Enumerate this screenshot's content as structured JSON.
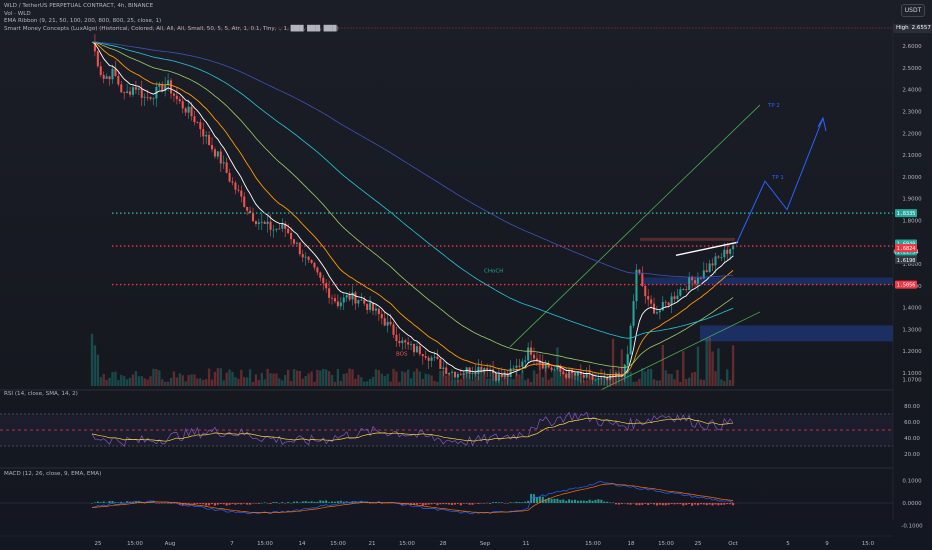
{
  "header": {
    "symbol_line": "WLD / TetherUS PERPETUAL CONTRACT, 4h, BINANCE",
    "indicators": [
      "Vol · WLD",
      "EMA Ribbon (9, 21, 50, 100, 200, 800, 800, 25, close, 1)",
      "Smart Money Concepts (LuxAlgo) (Historical, Colored, All, All, All, Small, 50, 5, 5, Atr, 1, 0.1, Tiny, ., 1, ███, ███, ███)"
    ],
    "currency_button": "USDT"
  },
  "price_axis": {
    "high_label": "High",
    "high_value": "2.6557",
    "ticks": [
      "2.6000",
      "2.5000",
      "2.4000",
      "2.3000",
      "2.2000",
      "2.1000",
      "2.0000",
      "1.9000",
      "1.8000",
      "1.6000",
      "1.5000",
      "1.4000",
      "1.3000",
      "1.2000",
      "1.1000",
      "1.0700"
    ],
    "badges": [
      {
        "text": "1.8335",
        "color": "#26a69a"
      },
      {
        "text": "1.6940",
        "color": "#26a69a"
      },
      {
        "text": "01:21:54",
        "color": "#26a69a"
      },
      {
        "text": "1.6824",
        "color": "#f23645"
      },
      {
        "text": "1.6190",
        "color": "#363a45"
      },
      {
        "text": "1.5056",
        "color": "#f23645"
      }
    ]
  },
  "rsi_panel": {
    "title": "RSI (14, close, SMA, 14, 2)",
    "ticks": [
      "80.00",
      "60.00",
      "40.00",
      "20.00"
    ]
  },
  "macd_panel": {
    "title": "MACD (12, 26, close, 9, EMA, EMA)",
    "ticks": [
      "0.1000",
      "0.0000",
      "-0.1000"
    ]
  },
  "time_axis": [
    "25",
    "15:00",
    "Aug",
    "7",
    "15:00",
    "14",
    "15:00",
    "21",
    "15:00",
    "28",
    "Sep",
    "11",
    "15:00",
    "18",
    "15:00",
    "25",
    "Oct",
    "5",
    "9",
    "15:0"
  ],
  "annotations": {
    "tp1": "TP 1",
    "tp2": "TP 2",
    "bos": "BOS",
    "choch": "CHoCH",
    "choch2": "CHoCH"
  },
  "colors": {
    "background": "#131722",
    "up": "#26a69a",
    "down": "#ef5350",
    "ema_fast": "#ffffff",
    "ema_mid": "#ff9800",
    "ema_slow1": "#9ccc65",
    "ema_slow2": "#26c6da",
    "ema_slow3": "#3f51b5",
    "channel": "#4caf50",
    "projection": "#2962ff"
  },
  "chart_data": [
    {
      "type": "candlestick",
      "title": "WLD / TetherUS PERPETUAL CONTRACT, 4h, BINANCE",
      "ylim": [
        1.04,
        2.72
      ],
      "log_scale": false,
      "grid": false,
      "path_prices": [
        2.62,
        2.45,
        2.48,
        2.37,
        2.42,
        2.36,
        2.39,
        2.43,
        2.35,
        2.3,
        2.24,
        2.15,
        2.08,
        1.98,
        1.9,
        1.82,
        1.78,
        1.76,
        1.77,
        1.7,
        1.62,
        1.55,
        1.48,
        1.42,
        1.45,
        1.44,
        1.4,
        1.36,
        1.3,
        1.24,
        1.21,
        1.2,
        1.16,
        1.12,
        1.1,
        1.11,
        1.12,
        1.13,
        1.08,
        1.09,
        1.14,
        1.21,
        1.15,
        1.12,
        1.1,
        1.09,
        1.08,
        1.07,
        1.06,
        1.08,
        1.12,
        1.58,
        1.42,
        1.38,
        1.43,
        1.48,
        1.52,
        1.55,
        1.6,
        1.64,
        1.69
      ],
      "key_levels": [
        {
          "price": 1.8335,
          "style": "dotted",
          "color": "#26a69a"
        },
        {
          "price": 1.6824,
          "style": "dotted",
          "color": "#f23645"
        },
        {
          "price": 1.5056,
          "style": "dotted",
          "color": "#f23645"
        }
      ],
      "projection_path": [
        1.69,
        1.98,
        1.85,
        2.27
      ],
      "targets": [
        {
          "label": "TP 1",
          "price": 1.99
        },
        {
          "label": "TP 2",
          "price": 2.32
        }
      ]
    },
    {
      "type": "line",
      "title": "RSI (14, close, SMA, 14, 2)",
      "ylim": [
        10,
        90
      ],
      "levels": [
        70,
        50,
        30
      ]
    },
    {
      "type": "bar",
      "title": "MACD (12, 26, close, 9, EMA, EMA)",
      "ylim": [
        -0.12,
        0.12
      ]
    }
  ]
}
